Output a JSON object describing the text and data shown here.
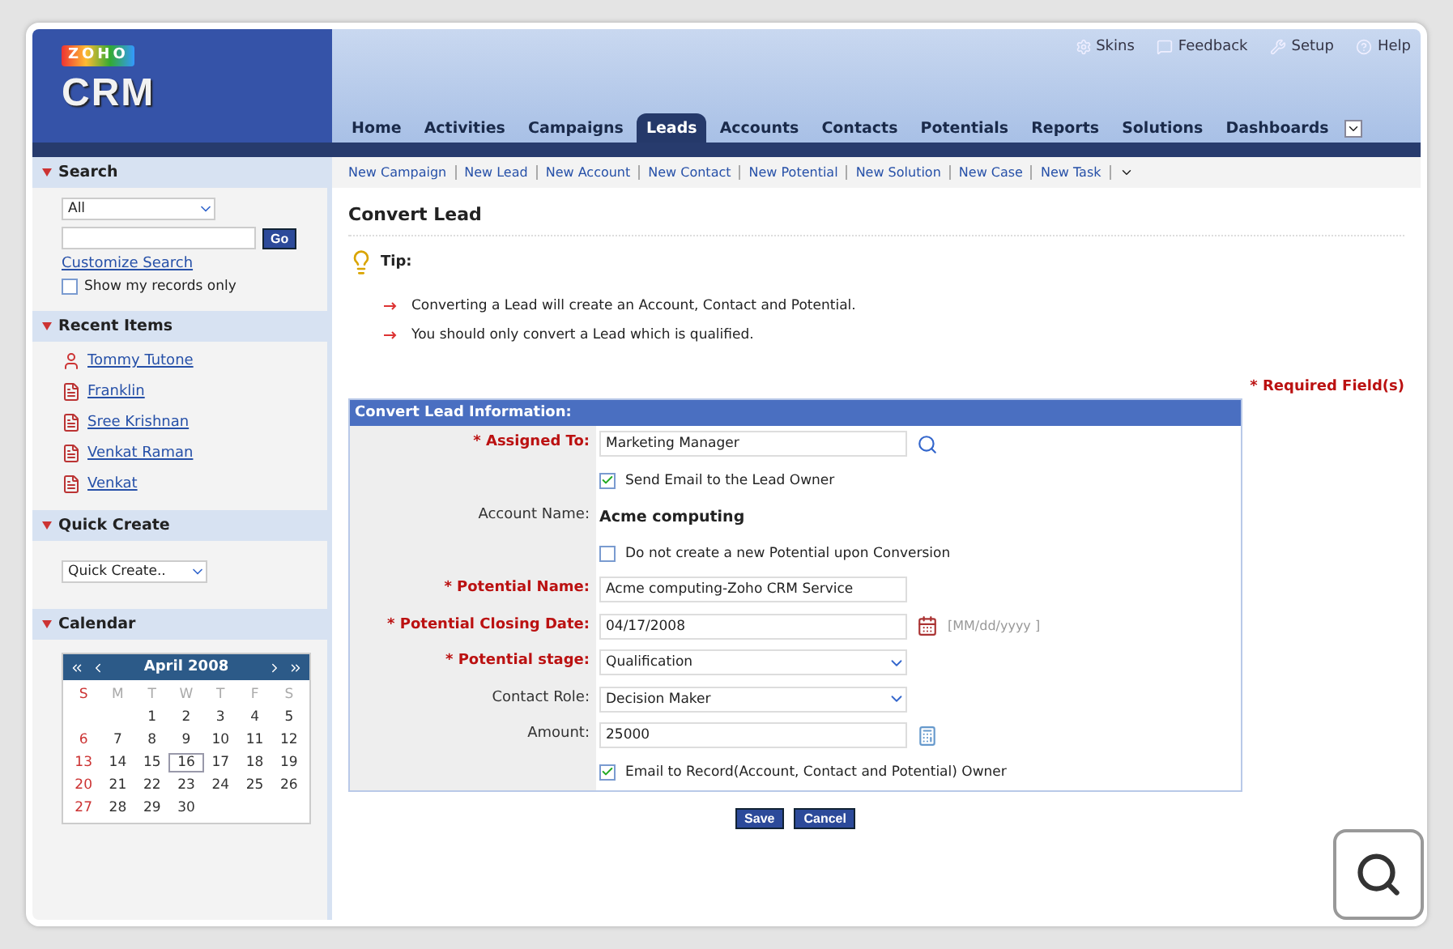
{
  "header": {
    "logo_badge": "ZOHO",
    "logo": "CRM",
    "top_links": [
      {
        "kind": "skins",
        "label": "Skins"
      },
      {
        "kind": "feedback",
        "label": "Feedback"
      },
      {
        "kind": "setup",
        "label": "Setup"
      },
      {
        "kind": "help",
        "label": "Help"
      }
    ],
    "tabs": [
      {
        "label": "Home",
        "selected": false
      },
      {
        "label": "Activities",
        "selected": false
      },
      {
        "label": "Campaigns",
        "selected": false
      },
      {
        "label": "Leads",
        "selected": true
      },
      {
        "label": "Accounts",
        "selected": false
      },
      {
        "label": "Contacts",
        "selected": false
      },
      {
        "label": "Potentials",
        "selected": false
      },
      {
        "label": "Reports",
        "selected": false
      },
      {
        "label": "Solutions",
        "selected": false
      },
      {
        "label": "Dashboards",
        "selected": false
      }
    ]
  },
  "sidebar": {
    "search": {
      "title": "Search",
      "module": "All",
      "go": "Go",
      "customize": "Customize Search",
      "show_mine": {
        "label": "Show my records only",
        "checked": false
      }
    },
    "recent": {
      "title": "Recent Items",
      "items": [
        {
          "kind": "contact",
          "label": "Tommy Tutone"
        },
        {
          "kind": "lead",
          "label": "Franklin"
        },
        {
          "kind": "lead",
          "label": "Sree Krishnan"
        },
        {
          "kind": "lead",
          "label": "Venkat Raman"
        },
        {
          "kind": "lead",
          "label": "Venkat"
        }
      ]
    },
    "quick_create": {
      "title": "Quick Create",
      "value": "Quick Create.."
    },
    "calendar": {
      "title": "Calendar",
      "month": "April 2008",
      "weekdays": [
        "S",
        "M",
        "T",
        "W",
        "T",
        "F",
        "S"
      ],
      "weeks": [
        {
          "kind": "first",
          "days": [
            {
              "d": "1",
              "selected": false
            },
            {
              "d": "2",
              "selected": false
            },
            {
              "d": "3",
              "selected": false
            },
            {
              "d": "4",
              "selected": false
            },
            {
              "d": "5",
              "selected": false
            }
          ]
        },
        {
          "kind": "week",
          "days": [
            {
              "d": "6",
              "selected": false
            },
            {
              "d": "7",
              "selected": false
            },
            {
              "d": "8",
              "selected": false
            },
            {
              "d": "9",
              "selected": false
            },
            {
              "d": "10",
              "selected": false
            },
            {
              "d": "11",
              "selected": false
            },
            {
              "d": "12",
              "selected": false
            }
          ]
        },
        {
          "kind": "week",
          "days": [
            {
              "d": "13",
              "selected": false
            },
            {
              "d": "14",
              "selected": false
            },
            {
              "d": "15",
              "selected": false
            },
            {
              "d": "16",
              "selected": true
            },
            {
              "d": "17",
              "selected": false
            },
            {
              "d": "18",
              "selected": false
            },
            {
              "d": "19",
              "selected": false
            }
          ]
        },
        {
          "kind": "week",
          "days": [
            {
              "d": "20",
              "selected": false
            },
            {
              "d": "21",
              "selected": false
            },
            {
              "d": "22",
              "selected": false
            },
            {
              "d": "23",
              "selected": false
            },
            {
              "d": "24",
              "selected": false
            },
            {
              "d": "25",
              "selected": false
            },
            {
              "d": "26",
              "selected": false
            }
          ]
        },
        {
          "kind": "week",
          "days": [
            {
              "d": "27",
              "selected": false
            },
            {
              "d": "28",
              "selected": false
            },
            {
              "d": "29",
              "selected": false
            },
            {
              "d": "30",
              "selected": false
            }
          ]
        }
      ]
    }
  },
  "quick_links": [
    "New Campaign",
    "New Lead",
    "New Account",
    "New Contact",
    "New Potential",
    "New Solution",
    "New Case",
    "New Task"
  ],
  "main": {
    "title": "Convert Lead",
    "tip_title": "Tip:",
    "tips": [
      "Converting a Lead will create an Account, Contact and Potential.",
      "You should only convert a Lead which is qualified."
    ],
    "required_note": "* Required Field(s)",
    "form": {
      "title": "Convert Lead Information:",
      "rows": [
        {
          "kind": "lookup",
          "label": "* Assigned To:",
          "required": true,
          "value": "Marketing Manager"
        },
        {
          "kind": "checkbox",
          "label": "Send Email to the Lead Owner",
          "checked": true
        },
        {
          "kind": "static",
          "label": "Account Name:",
          "required": false,
          "value": "Acme computing"
        },
        {
          "kind": "checkbox",
          "label": "Do not create a new Potential upon Conversion",
          "checked": false
        },
        {
          "kind": "text",
          "label": "* Potential Name:",
          "required": true,
          "value": "Acme computing-Zoho CRM Service"
        },
        {
          "kind": "date",
          "label": "* Potential Closing Date:",
          "required": true,
          "value": "04/17/2008",
          "hint": "[MM/dd/yyyy ]"
        },
        {
          "kind": "select",
          "label": "* Potential stage:",
          "required": true,
          "value": "Qualification"
        },
        {
          "kind": "select",
          "label": "Contact Role:",
          "required": false,
          "value": "Decision Maker"
        },
        {
          "kind": "amount",
          "label": "Amount:",
          "required": false,
          "value": "25000"
        },
        {
          "kind": "checkbox",
          "label": "Email to Record(Account, Contact and Potential) Owner",
          "checked": true
        }
      ]
    },
    "buttons": [
      "Save",
      "Cancel"
    ]
  }
}
